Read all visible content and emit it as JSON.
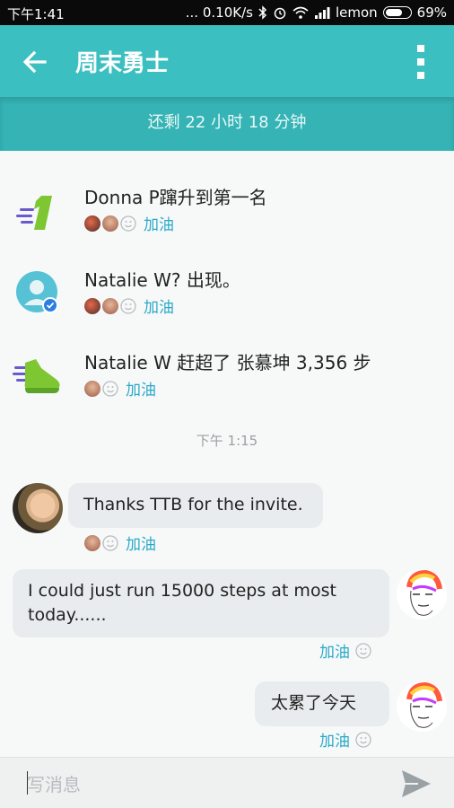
{
  "status_bar": {
    "time": "下午1:41",
    "network_speed": "... 0.10K/s",
    "carrier": "lemon",
    "battery": "69%",
    "battery_level": 0.69
  },
  "header": {
    "title": "周末勇士",
    "back_icon": "arrow-left-icon",
    "menu_icon": "more-vertical-icon"
  },
  "timer": "还剩 22 小时 18 分钟",
  "feed": [
    {
      "text": "Donna P蹿升到第一名",
      "icon": "rank-one-icon",
      "cheer": "加油"
    },
    {
      "text": "Natalie W? 出现。",
      "icon": "user-verified-icon",
      "cheer": "加油"
    },
    {
      "text": "Natalie W 赶超了 张慕坤 3,356 步",
      "icon": "sneaker-icon",
      "cheer": "加油"
    }
  ],
  "timestamp": "下午 1:15",
  "messages": [
    {
      "text": "Thanks TTB for the invite.",
      "cheer": "加油"
    },
    {
      "text_line1": "I could just run 15000 steps at most",
      "text_line2": "today......",
      "cheer": "加油"
    },
    {
      "text": "太累了今天",
      "cheer": "加油"
    }
  ],
  "composer": {
    "placeholder": "写消息",
    "send_icon": "send-icon"
  },
  "colors": {
    "accent": "#3cbfc1",
    "cheer": "#2ba9c8",
    "bubble": "#e9ecee"
  }
}
